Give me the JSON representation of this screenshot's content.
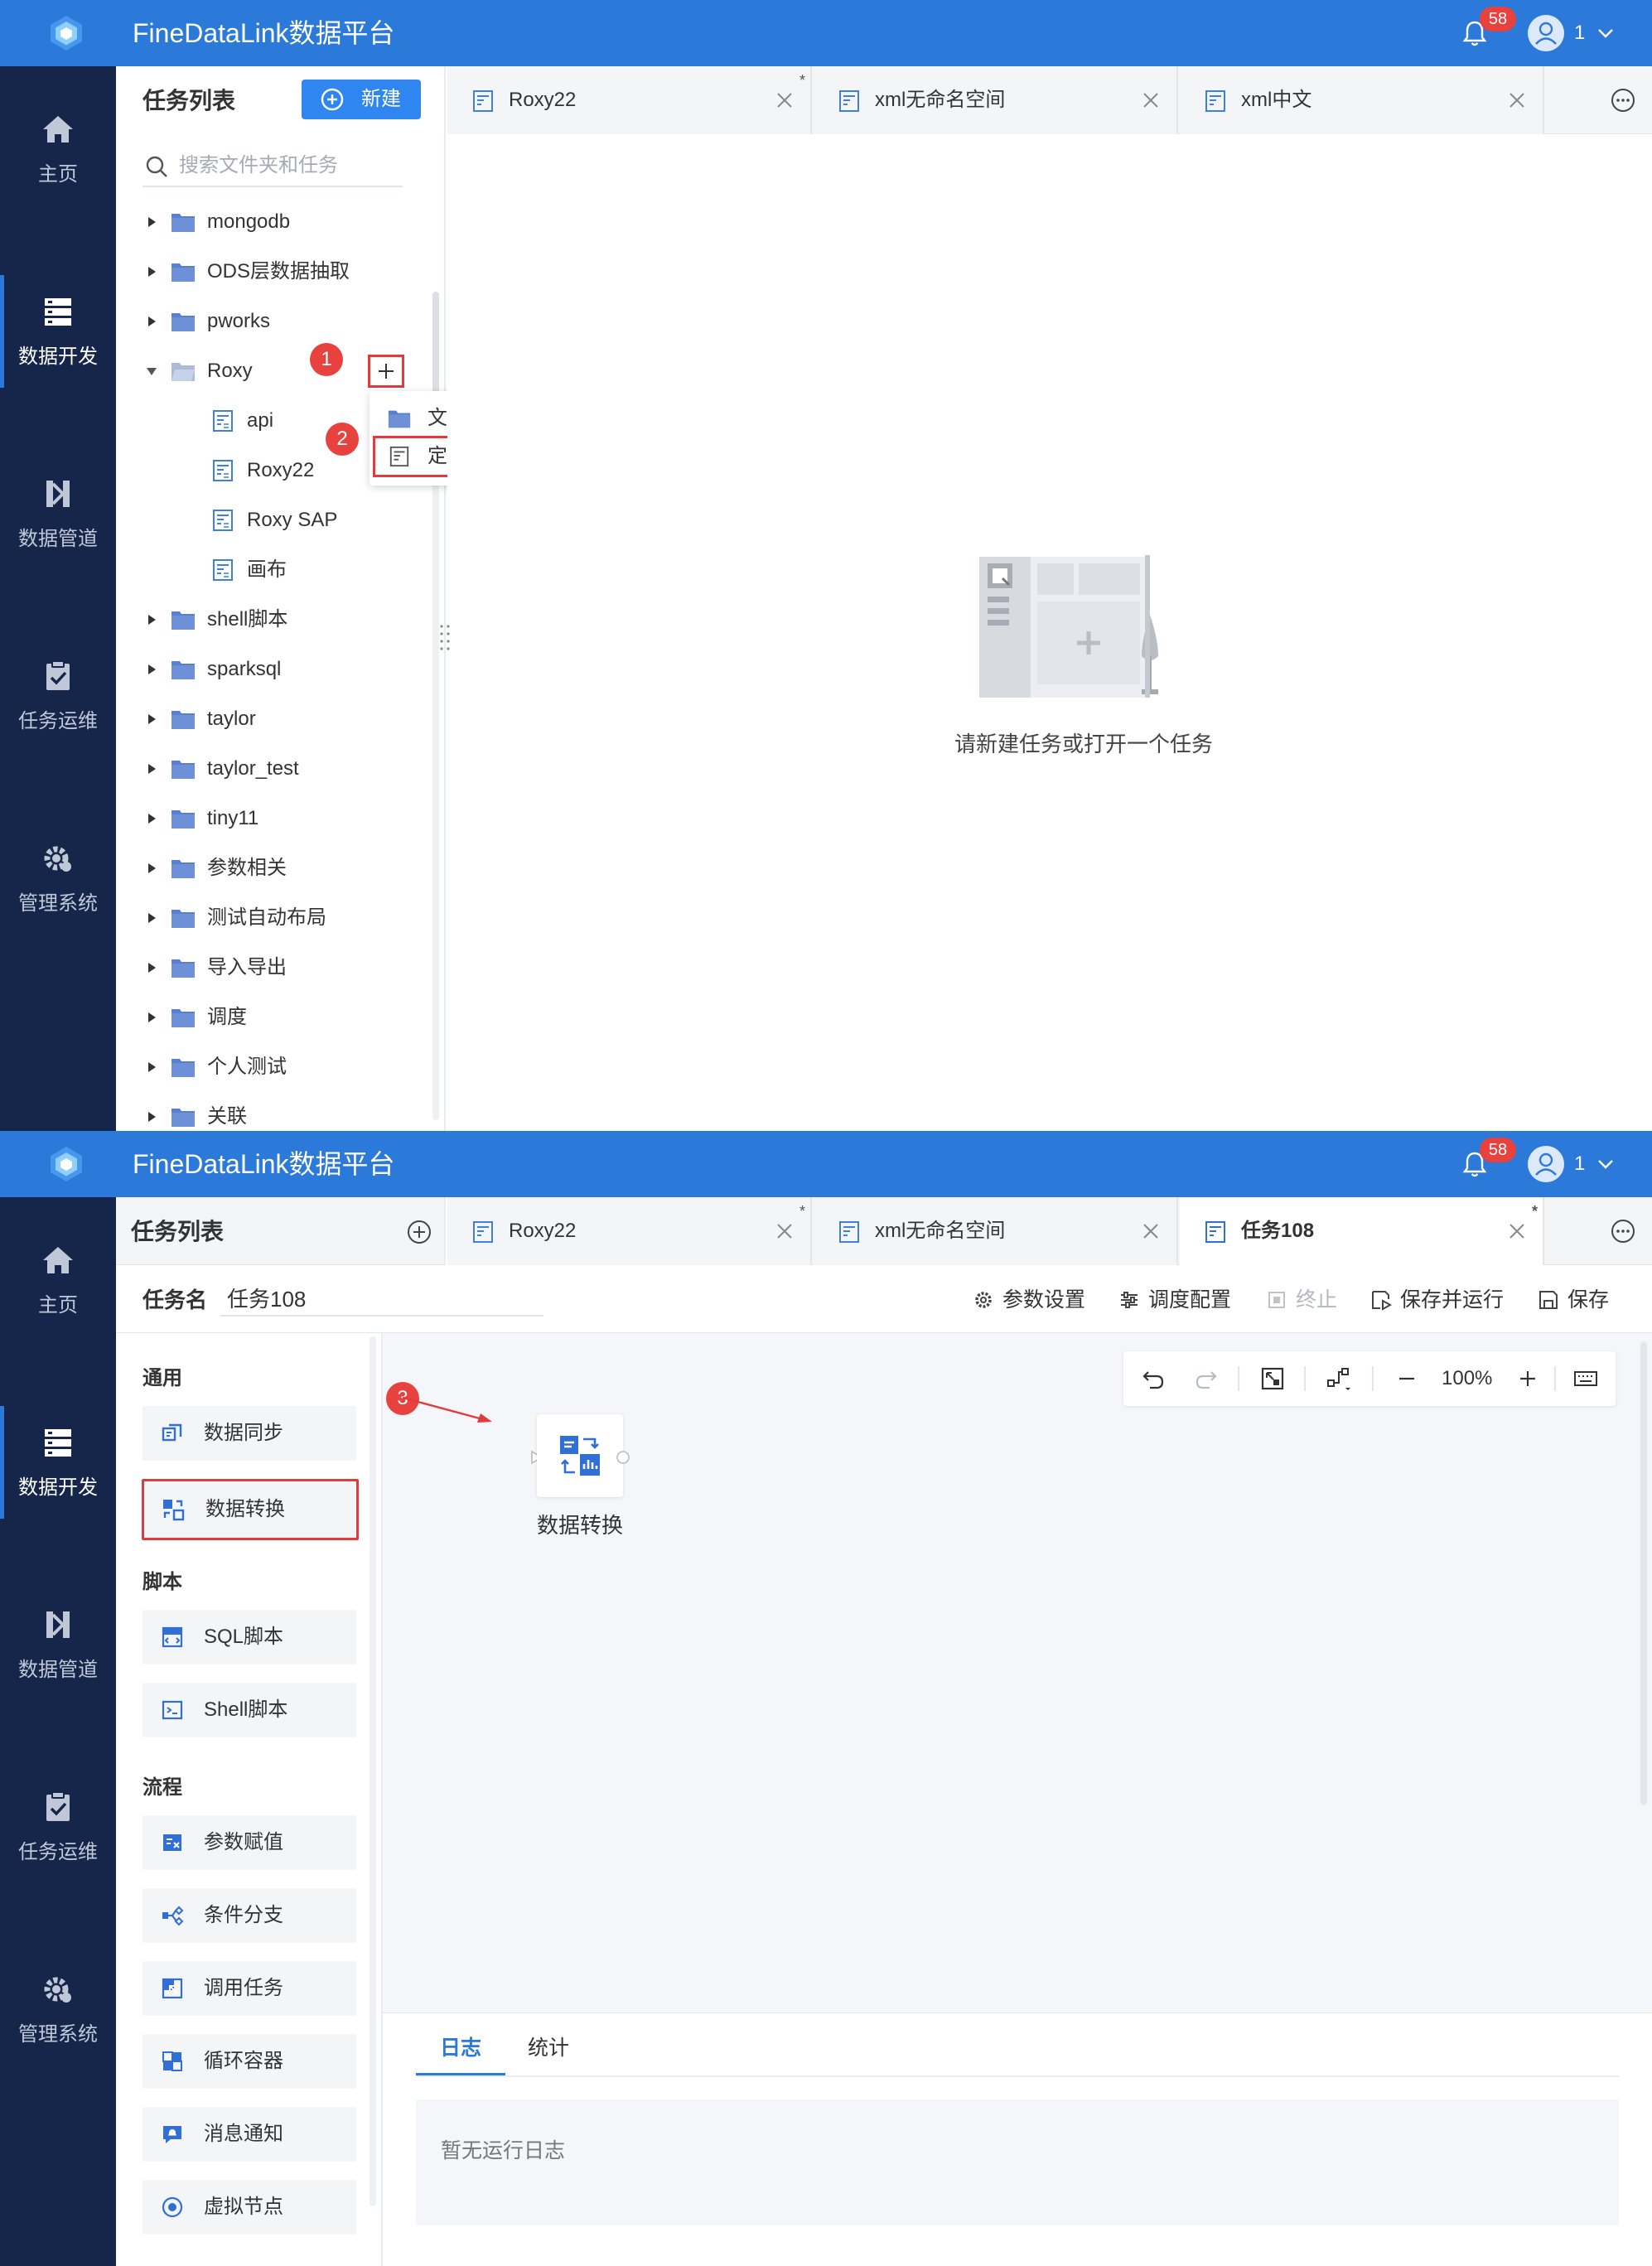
{
  "app": {
    "title": "FineDataLink数据平台",
    "notification_count": "58",
    "user_name": "1"
  },
  "nav": {
    "items": [
      {
        "label": "主页",
        "icon": "home-icon"
      },
      {
        "label": "数据开发",
        "icon": "server-icon",
        "active": true
      },
      {
        "label": "数据管道",
        "icon": "pipeline-icon"
      },
      {
        "label": "任务运维",
        "icon": "clipboard-check-icon"
      },
      {
        "label": "管理系统",
        "icon": "gear-icon"
      }
    ]
  },
  "shot1": {
    "panel": {
      "title": "任务列表",
      "new_button": "新建",
      "search_placeholder": "搜索文件夹和任务",
      "tree": [
        {
          "label": "mongodb",
          "type": "folder",
          "expanded": false
        },
        {
          "label": "ODS层数据抽取",
          "type": "folder",
          "expanded": false
        },
        {
          "label": "pworks",
          "type": "folder",
          "expanded": false
        },
        {
          "label": "Roxy",
          "type": "folder",
          "expanded": true
        },
        {
          "label": "api",
          "type": "task"
        },
        {
          "label": "Roxy22",
          "type": "task"
        },
        {
          "label": "Roxy SAP",
          "type": "task"
        },
        {
          "label": "画布",
          "type": "task"
        },
        {
          "label": "shell脚本",
          "type": "folder",
          "expanded": false
        },
        {
          "label": "sparksql",
          "type": "folder",
          "expanded": false
        },
        {
          "label": "taylor",
          "type": "folder",
          "expanded": false
        },
        {
          "label": "taylor_test",
          "type": "folder",
          "expanded": false
        },
        {
          "label": "tiny11",
          "type": "folder",
          "expanded": false
        },
        {
          "label": "参数相关",
          "type": "folder",
          "expanded": false
        },
        {
          "label": "测试自动布局",
          "type": "folder",
          "expanded": false
        },
        {
          "label": "导入导出",
          "type": "folder",
          "expanded": false
        },
        {
          "label": "调度",
          "type": "folder",
          "expanded": false
        },
        {
          "label": "个人测试",
          "type": "folder",
          "expanded": false
        },
        {
          "label": "关联",
          "type": "folder",
          "expanded": false
        }
      ]
    },
    "context_menu": {
      "items": [
        "文件夹",
        "定时任务"
      ]
    },
    "steps": [
      "1",
      "2"
    ],
    "tabs": [
      {
        "label": "Roxy22",
        "dirty": "*"
      },
      {
        "label": "xml无命名空间",
        "dirty": ""
      },
      {
        "label": "xml中文",
        "dirty": ""
      }
    ],
    "empty_text": "请新建任务或打开一个任务"
  },
  "shot2": {
    "panel_title": "任务列表",
    "tabs": [
      {
        "label": "Roxy22",
        "dirty": "*"
      },
      {
        "label": "xml无命名空间",
        "dirty": ""
      },
      {
        "label": "任务108",
        "dirty": "*",
        "active": true
      }
    ],
    "task_name_label": "任务名",
    "task_name_value": "任务108",
    "toolbar": [
      "参数设置",
      "调度配置",
      "终止",
      "保存并运行",
      "保存"
    ],
    "sections": [
      {
        "title": "通用",
        "items": [
          "数据同步",
          "数据转换"
        ]
      },
      {
        "title": "脚本",
        "items": [
          "SQL脚本",
          "Shell脚本"
        ]
      },
      {
        "title": "流程",
        "items": [
          "参数赋值",
          "条件分支",
          "调用任务",
          "循环容器",
          "消息通知",
          "虚拟节点"
        ]
      }
    ],
    "step": "3",
    "zoom": "100%",
    "canvas_node_label": "数据转换",
    "log_tabs": [
      "日志",
      "统计"
    ],
    "log_empty": "暂无运行日志"
  },
  "colors": {
    "brand": "#2b79d8",
    "nav_bg": "#15264a",
    "highlight": "#e13b3b",
    "badge": "#e8423f"
  }
}
